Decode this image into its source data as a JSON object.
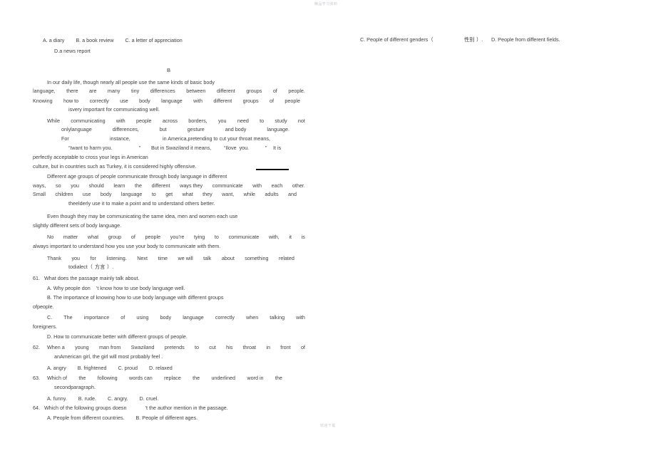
{
  "document": {
    "watermark_top": "精品学习资料",
    "watermark_bottom": "欢迎下载",
    "section_label": "B"
  },
  "question_60_options": {
    "line1": "A. a diary        B. a book review        C. a letter of appreciation",
    "line2": "D.a news report",
    "option_c_right": "C. People of different genders（",
    "option_c_right_cn": "性别",
    "option_c_right_tail": "）.",
    "option_d_right": "D. People from different fields."
  },
  "passage": {
    "p1": {
      "l1": "In our daily life, though nearly all people use the same kinds of basic body",
      "l2": [
        "language,",
        "there",
        "are",
        "many",
        "tiny",
        "differences",
        "between",
        "different",
        "groups",
        "of",
        "people."
      ],
      "l3": [
        "Knowing",
        "how to",
        "correctly",
        "use",
        "body",
        "language",
        "with",
        "different",
        "groups",
        "of",
        "people"
      ],
      "l4": "isvery important for communicating well."
    },
    "p2": {
      "l1": [
        "While",
        "communicating",
        "with",
        "people",
        "across",
        "borders,",
        "you",
        "need",
        "to",
        "study",
        "not"
      ],
      "l2": [
        "onlylanguage",
        "differences,",
        "but",
        "gesture",
        "and body",
        "language."
      ],
      "l3": [
        "For",
        "instance,",
        "in America,pretending to cut your throat means,"
      ],
      "l4": [
        "“Iwant to harm you.",
        "”",
        "But in Swaziland it means,",
        "“Ilove  you.",
        "”",
        "It is"
      ],
      "l5": "perfectly acceptable to cross your legs in American",
      "l6": "culture, but in countries such as Turkey, it is considered highly offensive."
    },
    "p3": {
      "l1": "Different age groups of people communicate through body language in different",
      "l2": [
        "ways,",
        "so",
        "you",
        "should",
        "learn",
        "the",
        "different",
        "ways they",
        "communicate",
        "with",
        "each",
        "other."
      ],
      "l3": [
        "Small",
        "children",
        "use",
        "body",
        "language",
        "to",
        "get",
        "what",
        "they",
        "want,",
        "while",
        "adults",
        "and"
      ],
      "l4": "theelderly use it to make a point and to understand others better."
    },
    "p4": {
      "l1": "Even though they may be communicating the same idea, men and women each use",
      "l2": "slightly different sets of body language."
    },
    "p5": {
      "l1": [
        "No",
        "matter",
        "what",
        "group",
        "of",
        "people",
        "you’re",
        "tying",
        "to",
        "communicate",
        "with,",
        "it",
        "is"
      ],
      "l2": "always important to understand how you use your body to communicate with them."
    },
    "p6": {
      "l1": [
        "Thank",
        "you",
        "for",
        "listening.",
        "Next",
        "time",
        "we will",
        "talk",
        "about",
        "something",
        "related"
      ],
      "l2_pre": "todialect（",
      "l2_cn": "方言",
      "l2_post": "）."
    }
  },
  "questions": [
    {
      "number": "61.",
      "stem": "What does the passage mainly talk about.",
      "options": [
        "A. Why people don    ’t know how to use body language well.",
        "B. The importance of knowing how to use body language with different groups",
        "ofpeople.",
        "D. How to communicate better with different groups of people."
      ],
      "option_c_words": [
        "C.",
        "The",
        "importance",
        "of",
        "using",
        "body",
        "language",
        "correctly",
        "when",
        "talking",
        "with"
      ],
      "option_c_tail": "foreigners."
    },
    {
      "number": "62.",
      "stem_words": [
        "When a",
        "young",
        "man from",
        "Swaziland",
        "pretends",
        "to",
        "cut",
        "his",
        "throat",
        "in",
        "front",
        "of"
      ],
      "stem_line2": "anAmerican girl, the girl will most probably feel .",
      "options_line": "A. angry        B. frightened        C. proud        D. relaxed"
    },
    {
      "number": "63.",
      "stem_words": [
        "Which of",
        "the",
        "following",
        "words can",
        "replace",
        "the",
        "underlined",
        "word in",
        "the"
      ],
      "stem_line2": "secondparagraph.",
      "options_line": "A. funny.        B. rude.        C. angry.        D. cruel."
    },
    {
      "number": "64.",
      "stem": "Which of the following groups doesn             ’t the author mention in the passage.",
      "options_line": "A. People from different countries.        B. People of different ages."
    }
  ]
}
